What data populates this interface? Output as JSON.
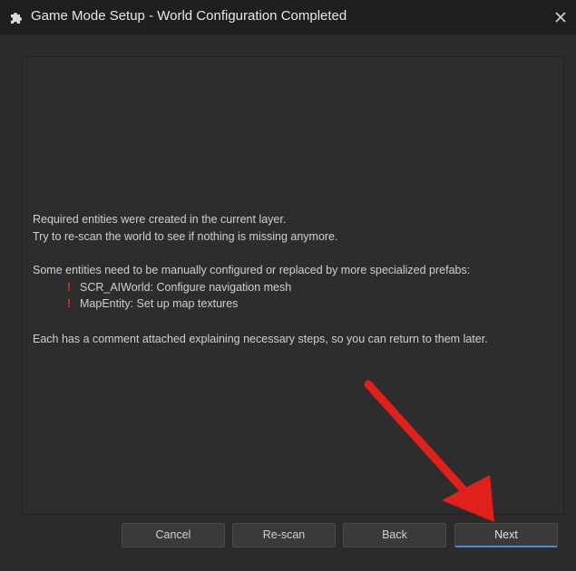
{
  "window": {
    "title": "Game Mode Setup - World Configuration Completed",
    "title_icon": "puzzle-icon",
    "close_icon": "close-icon"
  },
  "content": {
    "line1": "Required entities were created in the current layer.",
    "line2": "Try to re-scan the world to see if nothing is missing anymore.",
    "line3": "Some entities need to be manually configured or replaced by more specialized prefabs:",
    "bullets": [
      {
        "icon": "exclamation-icon",
        "mark": "!",
        "text": "SCR_AIWorld: Configure navigation mesh"
      },
      {
        "icon": "exclamation-icon",
        "mark": "!",
        "text": "MapEntity: Set up map textures"
      }
    ],
    "line4": "Each has a comment attached explaining necessary steps, so you can return to them later."
  },
  "buttons": {
    "cancel": "Cancel",
    "rescan": "Re-scan",
    "back": "Back",
    "next": "Next"
  },
  "colors": {
    "annotation_arrow": "#e0201a",
    "warning": "#e0332c",
    "next_accent": "#4a8fd6"
  }
}
